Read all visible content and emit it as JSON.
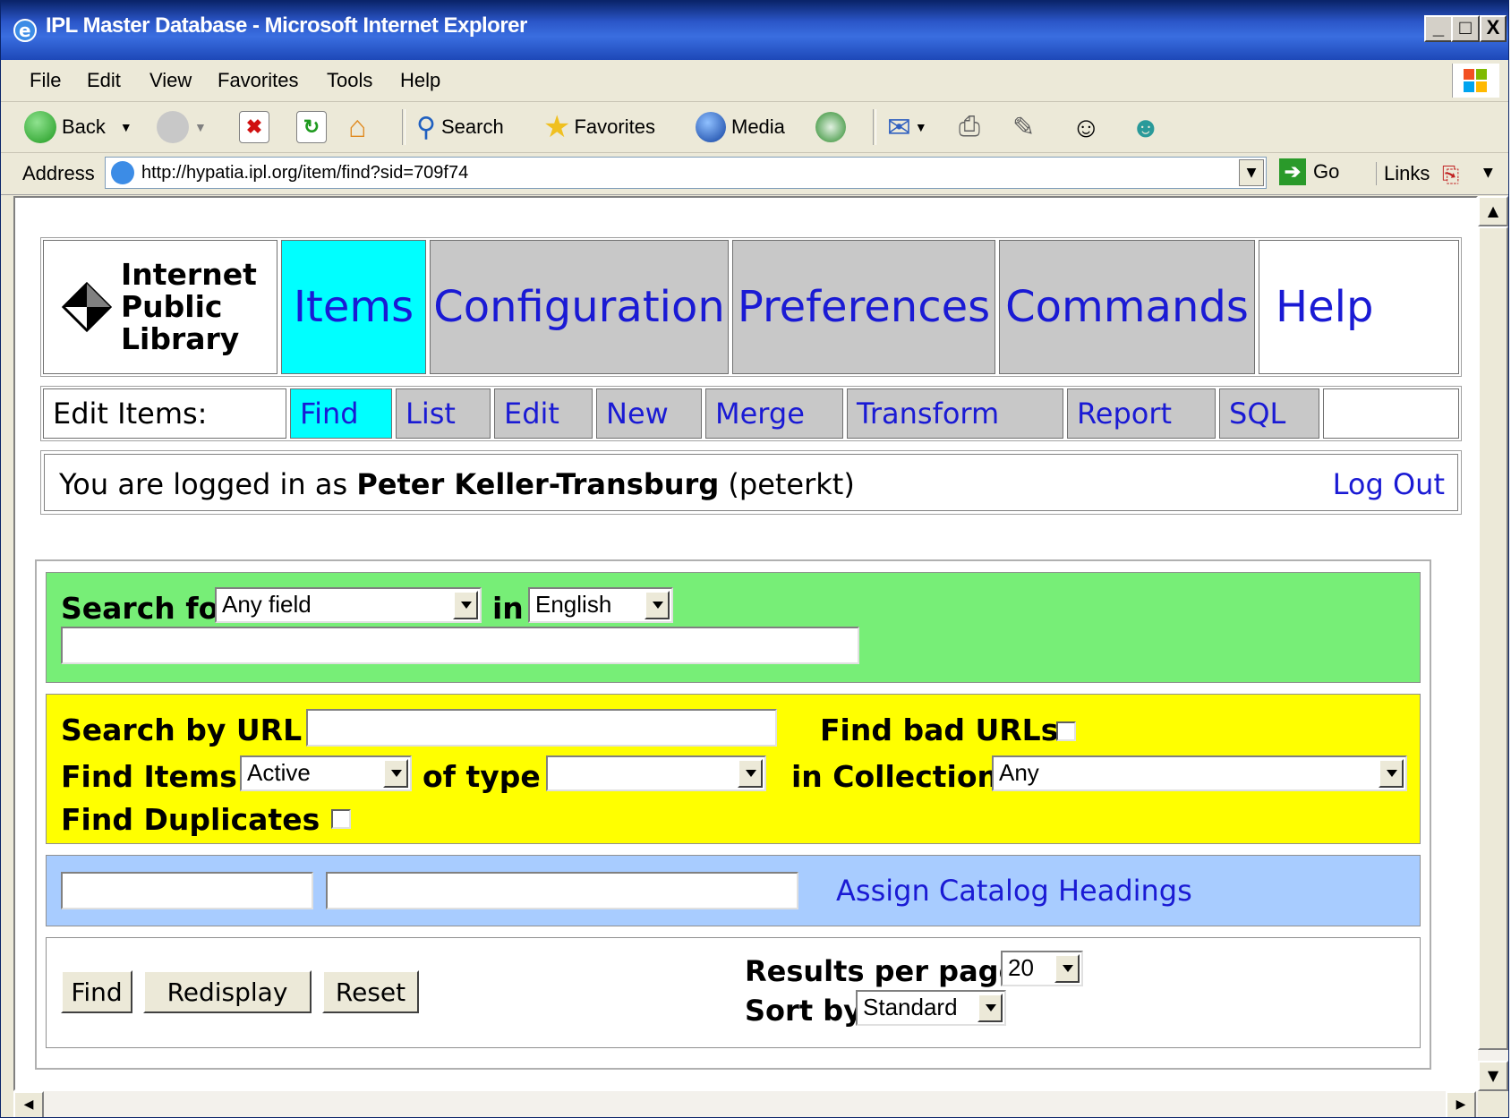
{
  "window": {
    "title": "IPL Master Database - Microsoft Internet Explorer",
    "controls": [
      "_",
      "□",
      "X"
    ]
  },
  "menu": [
    "File",
    "Edit",
    "View",
    "Favorites",
    "Tools",
    "Help"
  ],
  "toolbar": {
    "back": "Back",
    "search": "Search",
    "favorites": "Favorites",
    "media": "Media"
  },
  "address": {
    "label": "Address",
    "url": "http://hypatia.ipl.org/item/find?sid=709f74",
    "go": "Go",
    "links": "Links"
  },
  "logo": {
    "line1": "Internet",
    "line2": "Public",
    "line3": "Library"
  },
  "main_tabs": [
    {
      "label": "Items",
      "active": true
    },
    {
      "label": "Configuration",
      "active": false
    },
    {
      "label": "Preferences",
      "active": false
    },
    {
      "label": "Commands",
      "active": false
    },
    {
      "label": "Help",
      "active": false
    }
  ],
  "subnav": {
    "label": "Edit Items:",
    "tabs": [
      "Find",
      "List",
      "Edit",
      "New",
      "Merge",
      "Transform",
      "Report",
      "SQL"
    ]
  },
  "login": {
    "prefix": "You are logged in as",
    "name": "Peter Keller-Transburg",
    "username": "(peterkt)",
    "logout": "Log Out"
  },
  "search": {
    "search_for_label": "Search for",
    "field_value": "Any field",
    "in_label": "in",
    "language_value": "English",
    "query_value": ""
  },
  "url_search": {
    "label": "Search by URL",
    "bad_urls_label": "Find bad URLs",
    "find_items_label": "Find Items",
    "status_value": "Active",
    "of_type_label": "of type",
    "type_value": "",
    "in_collection_label": "in Collection",
    "collection_value": "Any",
    "duplicates_label": "Find Duplicates"
  },
  "catalog": {
    "assign_link": "Assign Catalog Headings"
  },
  "actions": {
    "find": "Find",
    "redisplay": "Redisplay",
    "reset": "Reset",
    "results_label": "Results per page",
    "results_value": "20",
    "sort_label": "Sort by",
    "sort_value": "Standard"
  },
  "colors": {
    "active_tab": "#00ffff",
    "inactive_tab": "#c8c8c8",
    "link": "#1a1ad4",
    "green_band": "#77ee77",
    "yellow_band": "#ffff00",
    "blue_band": "#a8ccff"
  }
}
